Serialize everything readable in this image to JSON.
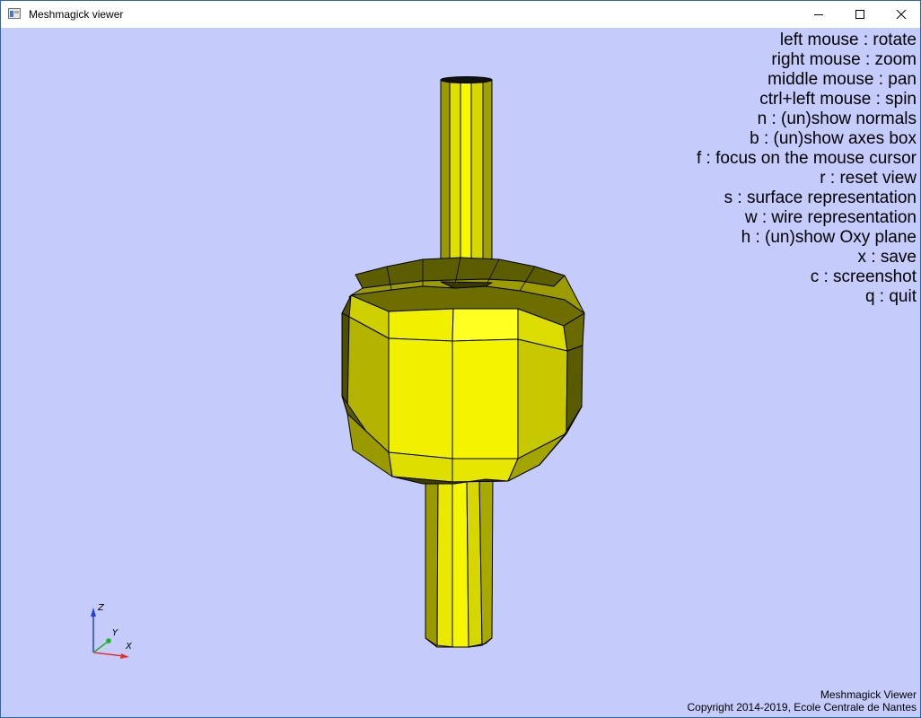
{
  "window": {
    "title": "Meshmagick viewer",
    "controls": [
      "minimize",
      "maximize",
      "close"
    ],
    "background_color": "#c5ccfc"
  },
  "help": {
    "lines": [
      "left mouse : rotate",
      "right mouse : zoom",
      "middle mouse : pan",
      "ctrl+left mouse : spin",
      "n : (un)show normals",
      "b : (un)show axes box",
      "f : focus on the mouse cursor",
      "r : reset view",
      "s : surface representation",
      "w : wire representation",
      "h : (un)show Oxy plane",
      "x : save",
      "c : screenshot",
      "q : quit"
    ]
  },
  "credits": {
    "name": "Meshmagick Viewer",
    "copyright": "Copyright 2014-2019, Ecole Centrale de Nantes"
  },
  "axes_widget": {
    "x_label": "X",
    "y_label": "Y",
    "z_label": "Z",
    "x_color": "#e53030",
    "y_color": "#20b020",
    "z_color": "#2040e0"
  },
  "mesh": {
    "color": "#f0f000",
    "edge_color": "#000000"
  }
}
